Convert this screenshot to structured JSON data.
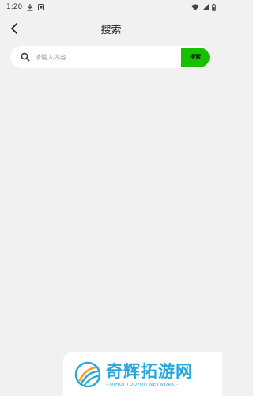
{
  "status_bar": {
    "time": "1:20"
  },
  "header": {
    "title": "搜索"
  },
  "search": {
    "placeholder": "请输入内容",
    "value": "",
    "button_label": "搜索"
  },
  "watermark": {
    "title": "奇辉拓游网",
    "subtitle": "- QIHUI TUOYOU NETWORK -"
  },
  "colors": {
    "accent": "#18c100",
    "background": "#f1f1f1",
    "watermark": "#27a7dc"
  }
}
